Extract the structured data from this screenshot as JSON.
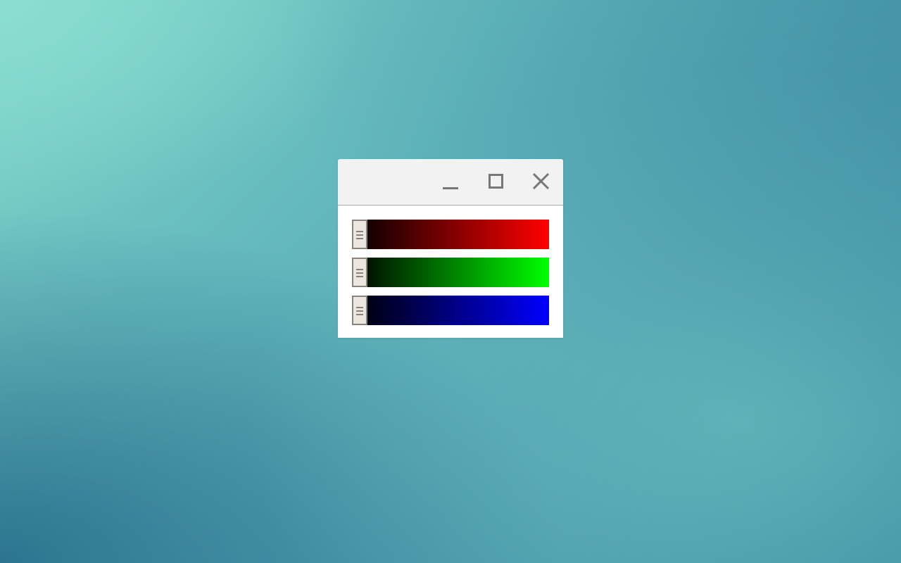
{
  "window": {
    "title": "",
    "controls": {
      "minimize_icon": "minimize-icon",
      "maximize_icon": "maximize-icon",
      "close_icon": "close-icon"
    }
  },
  "sliders": [
    {
      "channel": "red",
      "color": "#ff0000",
      "value_fraction": 0.0
    },
    {
      "channel": "green",
      "color": "#00ff00",
      "value_fraction": 0.0
    },
    {
      "channel": "blue",
      "color": "#0000ff",
      "value_fraction": 0.0
    }
  ],
  "colors": {
    "titlebar": "#f2f2f2",
    "window_bg": "#ffffff",
    "thumb_fill": "#ece6e0",
    "thumb_border": "#8a837c",
    "control_glyph": "#777777"
  }
}
